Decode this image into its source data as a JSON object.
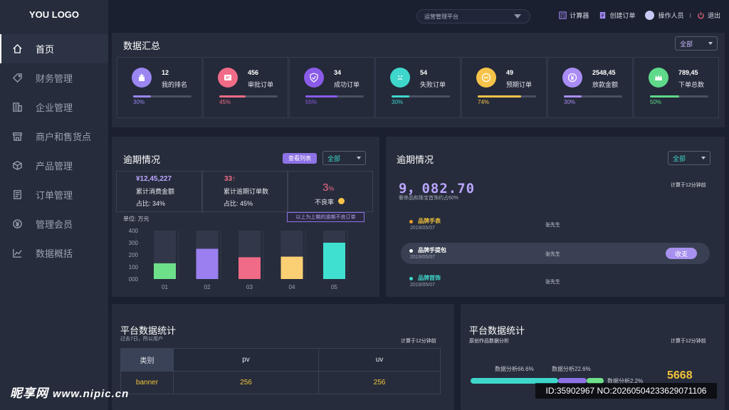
{
  "logo": "YOU LOGO",
  "nav": [
    {
      "label": "首页",
      "icon": "home-icon"
    },
    {
      "label": "财务管理",
      "icon": "tag-icon"
    },
    {
      "label": "企业管理",
      "icon": "building-icon"
    },
    {
      "label": "商户和售货点",
      "icon": "store-icon"
    },
    {
      "label": "产品管理",
      "icon": "box-icon"
    },
    {
      "label": "订单管理",
      "icon": "document-icon"
    },
    {
      "label": "管理会员",
      "icon": "yen-icon"
    },
    {
      "label": "数据概括",
      "icon": "line-chart-icon"
    }
  ],
  "topbar": {
    "platform": "运营管理平台",
    "calculator": "计算器",
    "create_order": "创建订单",
    "operator": "操作人员",
    "separator": "I",
    "logout": "退出"
  },
  "summary": {
    "title": "数据汇总",
    "filter": "全部",
    "cards": [
      {
        "value": "12",
        "label": "我的排名",
        "percent": "30%",
        "fill": 0.3,
        "color": "#9b86f2",
        "icon": "ranking-icon"
      },
      {
        "value": "456",
        "label": "审批订单",
        "percent": "45%",
        "fill": 0.45,
        "color": "#f06b87",
        "icon": "approval-icon"
      },
      {
        "value": "34",
        "label": "成功订单",
        "percent": "55%",
        "fill": 0.55,
        "color": "#8a5bea",
        "icon": "shield-check-icon"
      },
      {
        "value": "54",
        "label": "失败订单",
        "percent": "30%",
        "fill": 0.3,
        "color": "#3fd6cb",
        "icon": "sad-face-icon"
      },
      {
        "value": "49",
        "label": "预期订单",
        "percent": "74%",
        "fill": 0.74,
        "color": "#f6c34a",
        "icon": "minus-circle-icon"
      },
      {
        "value": "2548,45",
        "label": "放款金额",
        "percent": "30%",
        "fill": 0.3,
        "color": "#a98cf5",
        "icon": "yen-coin-icon"
      },
      {
        "value": "789,45",
        "label": "下单总数",
        "percent": "50%",
        "fill": 0.5,
        "color": "#5fd98a",
        "icon": "crown-icon"
      }
    ]
  },
  "overdue_left": {
    "title": "逾期情况",
    "button": "查看列表",
    "filter": "全部",
    "metric1": {
      "value": "¥12,45,227",
      "label": "累计消费金额",
      "ratio": "占比: 34%"
    },
    "metric2": {
      "value": "33↑",
      "label": "累计逾期订单数",
      "ratio": "占比: 45%"
    },
    "metric3": {
      "value": "3",
      "unit": "%",
      "label": "不良率"
    },
    "tooltip": "以上为上期的逾期不良订单",
    "unit": "单位: 万元"
  },
  "chart_data": {
    "type": "bar",
    "categories": [
      "01",
      "02",
      "03",
      "04",
      "05"
    ],
    "values": [
      130,
      250,
      180,
      185,
      300
    ],
    "colors": [
      "#6fe08a",
      "#9b7ff0",
      "#f06b87",
      "#fbcf73",
      "#3fe0cf"
    ],
    "background_max": 400,
    "ylim": [
      0,
      400
    ],
    "yticks": [
      "000",
      "100",
      "200",
      "300",
      "400"
    ]
  },
  "overdue_right": {
    "title": "逾期情况",
    "filter": "全部",
    "big_number": "9，082.70",
    "sub": "奢侈品和珠宝首饰约占60%",
    "calc_note": "计算于12分钟前",
    "items": [
      {
        "title": "品牌手表",
        "date": "2019/05/07",
        "user": "张先生",
        "color": "#f39c32"
      },
      {
        "title": "品牌手提包",
        "date": "2019/05/07",
        "user": "张先生",
        "color": "#ffffff",
        "action": "收支"
      },
      {
        "title": "品牌首饰",
        "date": "2019/05/07",
        "user": "张先生",
        "color": "#3fd6cb"
      }
    ]
  },
  "platform_left": {
    "title": "平台数据统计",
    "subtitle": "过去7日，所以用户",
    "calc_note": "计算于12分钟前",
    "headers": [
      "类别",
      "pv",
      "uv"
    ],
    "rows": [
      [
        "banner",
        "256",
        "256"
      ]
    ]
  },
  "platform_right": {
    "title": "平台数据统计",
    "subtitle": "原创作品数据分析",
    "calc_note": "计算于12分钟前",
    "segments": [
      {
        "label": "数据分析66.6%",
        "value": 66.6,
        "color": "#3fd6cb"
      },
      {
        "label": "数据分析22.6%",
        "value": 22.6,
        "color": "#8d72e6"
      },
      {
        "label": "数据分析2.2%",
        "value": 2.2,
        "color": "#6fe08a"
      }
    ],
    "total": "5668"
  },
  "watermark": {
    "brand": "昵享网",
    "url": "www.nipic.cn",
    "id_text": "ID:35902967 NO:20260504233629071106"
  }
}
